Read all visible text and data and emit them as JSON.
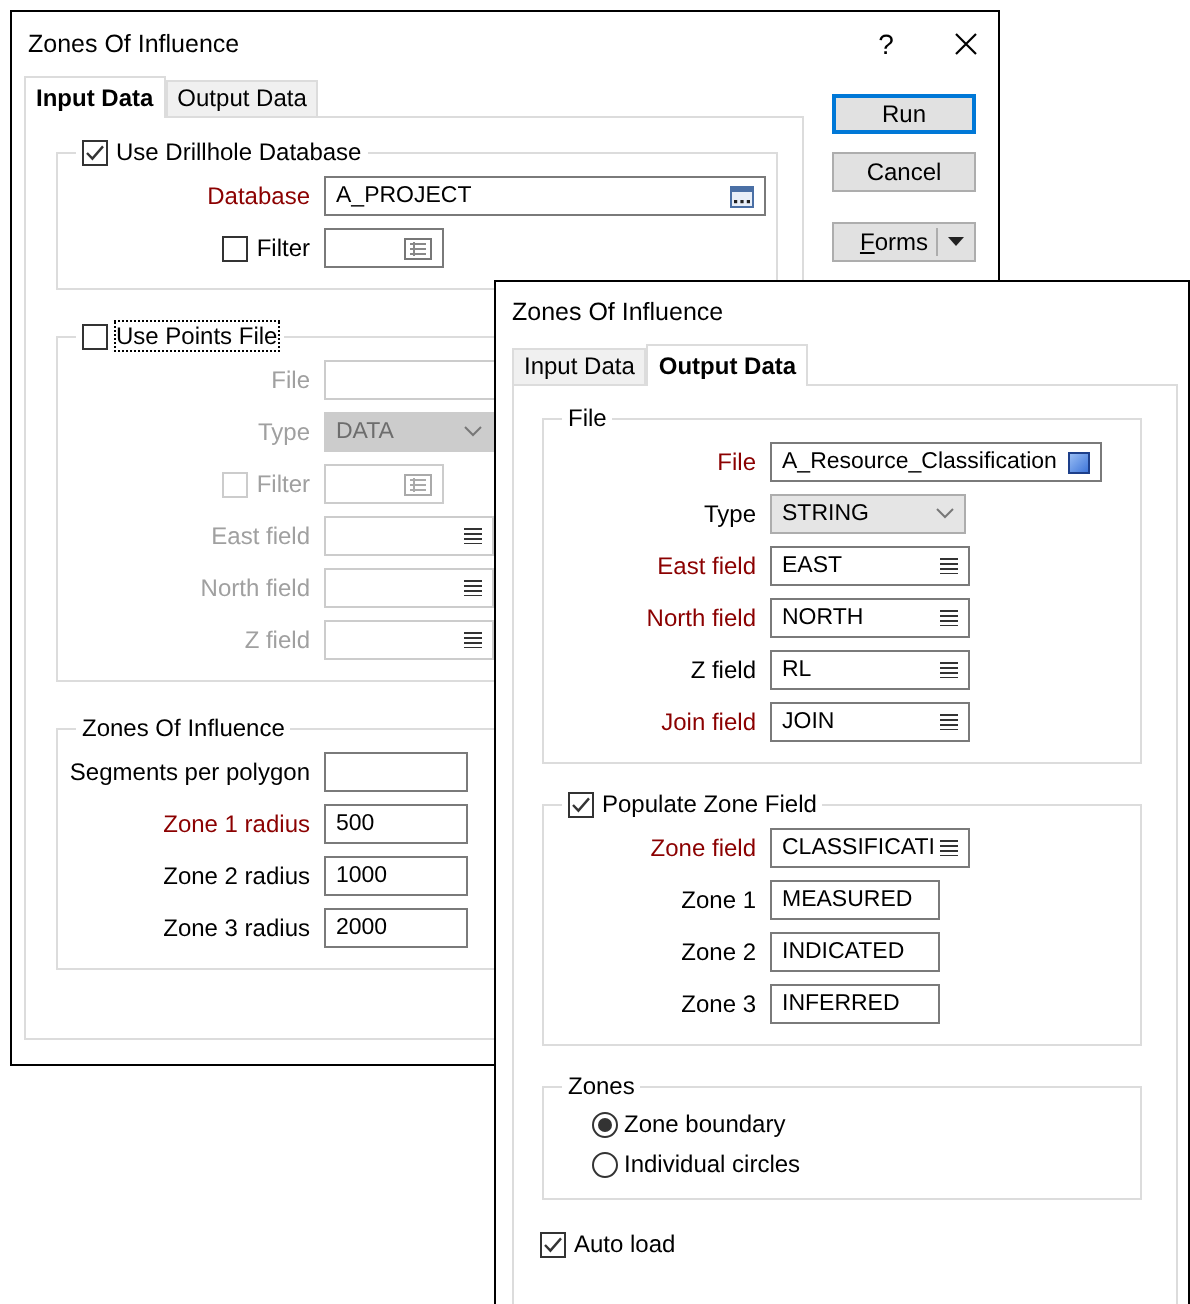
{
  "windows": [
    {
      "title": "Zones Of Influence",
      "help": "?",
      "tabs": [
        {
          "label": "Input Data",
          "selected": true
        },
        {
          "label": "Output Data",
          "selected": false
        }
      ],
      "groups": [
        {
          "header": {
            "kind": "checkbox",
            "label": "Use Drillhole Database",
            "checked": true,
            "focused": false
          },
          "rows": [
            {
              "kind": "browse",
              "label": "Database",
              "value": "A_PROJECT",
              "required": true,
              "disabled": false
            },
            {
              "kind": "filter",
              "label": "Filter",
              "checked": false,
              "required": false,
              "disabled": false
            }
          ]
        },
        {
          "header": {
            "kind": "checkbox",
            "label": "Use Points File",
            "checked": false,
            "focused": true
          },
          "rows": [
            {
              "kind": "file",
              "label": "File",
              "disabled": true
            },
            {
              "kind": "select",
              "label": "Type",
              "value": "DATA",
              "disabled": true
            },
            {
              "kind": "filter",
              "label": "Filter",
              "checked": false,
              "disabled": true
            },
            {
              "kind": "column",
              "label": "East field",
              "disabled": true
            },
            {
              "kind": "column",
              "label": "North field",
              "disabled": true
            },
            {
              "kind": "column",
              "label": "Z field",
              "disabled": true
            }
          ]
        },
        {
          "header": {
            "kind": "title",
            "label": "Zones Of Influence"
          },
          "rows": [
            {
              "kind": "text",
              "label": "Segments per polygon",
              "required": false,
              "disabled": false
            },
            {
              "kind": "text",
              "label": "Zone 1 radius",
              "value": "500",
              "required": true,
              "disabled": false
            },
            {
              "kind": "text",
              "label": "Zone 2 radius",
              "value": "1000",
              "required": false,
              "disabled": false
            },
            {
              "kind": "text",
              "label": "Zone 3 radius",
              "value": "2000",
              "required": false,
              "disabled": false
            }
          ]
        }
      ],
      "buttons": [
        {
          "kind": "push",
          "label": "Run",
          "default": true
        },
        {
          "kind": "push",
          "label": "Cancel",
          "default": false
        },
        {
          "kind": "split",
          "label": "Forms",
          "default": false
        }
      ]
    },
    {
      "title": "Zones Of Influence",
      "tabs": [
        {
          "label": "Input Data",
          "selected": false
        },
        {
          "label": "Output Data",
          "selected": true
        }
      ],
      "groups": [
        {
          "header": {
            "kind": "title",
            "label": "File"
          },
          "rows": [
            {
              "kind": "output_file",
              "label": "File",
              "value": "A_Resource_Classification",
              "required": true,
              "disabled": false
            },
            {
              "kind": "select",
              "label": "Type",
              "value": "STRING",
              "required": false,
              "disabled": false
            },
            {
              "kind": "column",
              "label": "East field",
              "value": "EAST",
              "required": true,
              "disabled": false
            },
            {
              "kind": "column",
              "label": "North field",
              "value": "NORTH",
              "required": true,
              "disabled": false
            },
            {
              "kind": "column",
              "label": "Z field",
              "value": "RL",
              "required": false,
              "disabled": false
            },
            {
              "kind": "column",
              "label": "Join field",
              "value": "JOIN",
              "required": true,
              "disabled": false
            }
          ]
        },
        {
          "header": {
            "kind": "checkbox",
            "label": "Populate Zone Field",
            "checked": true,
            "focused": false
          },
          "rows": [
            {
              "kind": "column",
              "label": "Zone field",
              "value": "CLASSIFICATI",
              "required": true,
              "disabled": false
            },
            {
              "kind": "text",
              "label": "Zone 1",
              "value": "MEASURED",
              "required": false,
              "disabled": false
            },
            {
              "kind": "text",
              "label": "Zone 2",
              "value": "INDICATED",
              "required": false,
              "disabled": false
            },
            {
              "kind": "text",
              "label": "Zone 3",
              "value": "INFERRED",
              "required": false,
              "disabled": false
            }
          ]
        },
        {
          "header": {
            "kind": "title",
            "label": "Zones"
          },
          "rows": [
            {
              "kind": "radio",
              "label": "Zone boundary",
              "selected": true
            },
            {
              "kind": "radio",
              "label": "Individual circles",
              "selected": false
            }
          ]
        }
      ],
      "options": [
        {
          "kind": "checkbox",
          "label": "Auto load",
          "checked": true
        }
      ]
    }
  ]
}
